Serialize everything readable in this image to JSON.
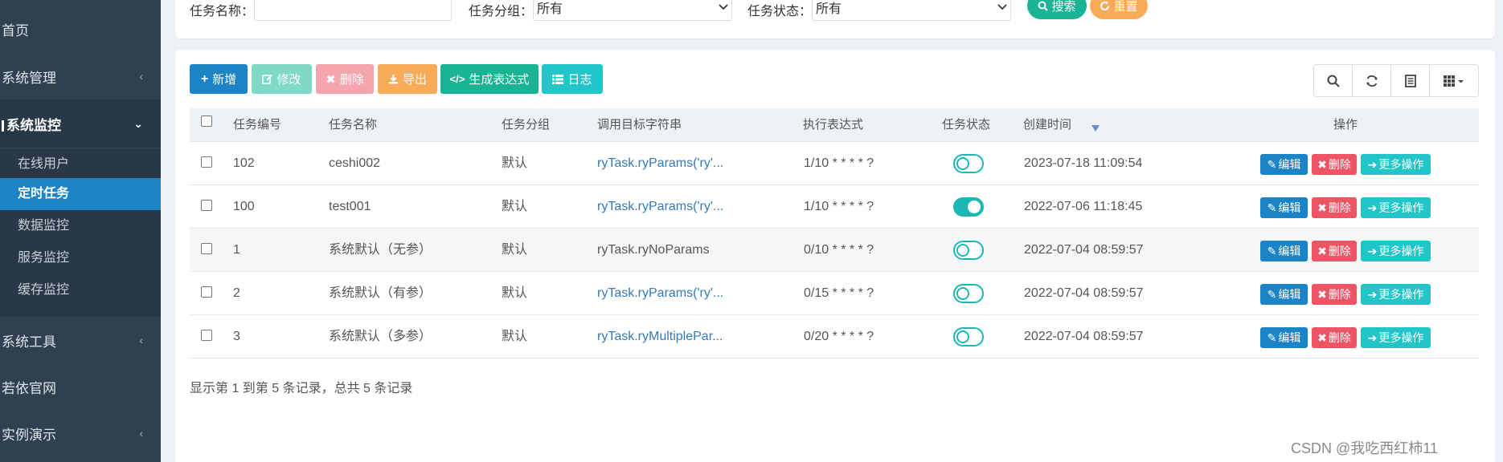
{
  "sidebar": {
    "items": [
      {
        "label": "首页",
        "chevron": ""
      },
      {
        "label": "系统管理",
        "chevron": "‹"
      },
      {
        "label": "系统监控",
        "chevron": "⌄"
      },
      {
        "label": "系统工具",
        "chevron": "‹"
      },
      {
        "label": "若依官网",
        "chevron": ""
      },
      {
        "label": "实例演示",
        "chevron": "‹"
      }
    ],
    "submenu": [
      "在线用户",
      "定时任务",
      "数据监控",
      "服务监控",
      "缓存监控"
    ],
    "current_submenu": "定时任务"
  },
  "search": {
    "name_label": "任务名称：",
    "name_value": "",
    "group_label": "任务分组：",
    "group_value": "所有",
    "status_label": "任务状态：",
    "status_value": "所有",
    "search_button": "搜索",
    "reset_button": "重置"
  },
  "toolbar": {
    "add": "新增",
    "edit": "修改",
    "delete": "删除",
    "export": "导出",
    "cron": "生成表达式",
    "log": "日志"
  },
  "table": {
    "headers": [
      "任务编号",
      "任务名称",
      "任务分组",
      "调用目标字符串",
      "执行表达式",
      "任务状态",
      "创建时间",
      "操作"
    ],
    "rows": [
      {
        "id": "102",
        "name": "ceshi002",
        "group": "默认",
        "target": "ryTask.ryParams('ry'...",
        "target_link": true,
        "cron": "1/10 * * * * ?",
        "status_on": false,
        "created": "2023-07-18 11:09:54"
      },
      {
        "id": "100",
        "name": "test001",
        "group": "默认",
        "target": "ryTask.ryParams('ry'...",
        "target_link": true,
        "cron": "1/10 * * * * ?",
        "status_on": true,
        "created": "2022-07-06 11:18:45"
      },
      {
        "id": "1",
        "name": "系统默认（无参）",
        "group": "默认",
        "target": "ryTask.ryNoParams",
        "target_link": false,
        "cron": "0/10 * * * * ?",
        "status_on": false,
        "created": "2022-07-04 08:59:57"
      },
      {
        "id": "2",
        "name": "系统默认（有参）",
        "group": "默认",
        "target": "ryTask.ryParams('ry'...",
        "target_link": true,
        "cron": "0/15 * * * * ?",
        "status_on": false,
        "created": "2022-07-04 08:59:57"
      },
      {
        "id": "3",
        "name": "系统默认（多参）",
        "group": "默认",
        "target": "ryTask.ryMultiplePar...",
        "target_link": true,
        "cron": "0/20 * * * * ?",
        "status_on": false,
        "created": "2022-07-04 08:59:57"
      }
    ],
    "row_actions": {
      "edit": "编辑",
      "delete": "删除",
      "more": "更多操作"
    }
  },
  "summary": "显示第 1 到第 5 条记录，总共 5 条记录",
  "watermark": "CSDN @我吃西红柿11",
  "colors": {
    "sidebar_bg": "#2f4050",
    "active_blue": "#1c84c6",
    "teal": "#1ab394",
    "cyan": "#23c6c8",
    "danger": "#ed5565",
    "warning": "#f8ac59"
  }
}
